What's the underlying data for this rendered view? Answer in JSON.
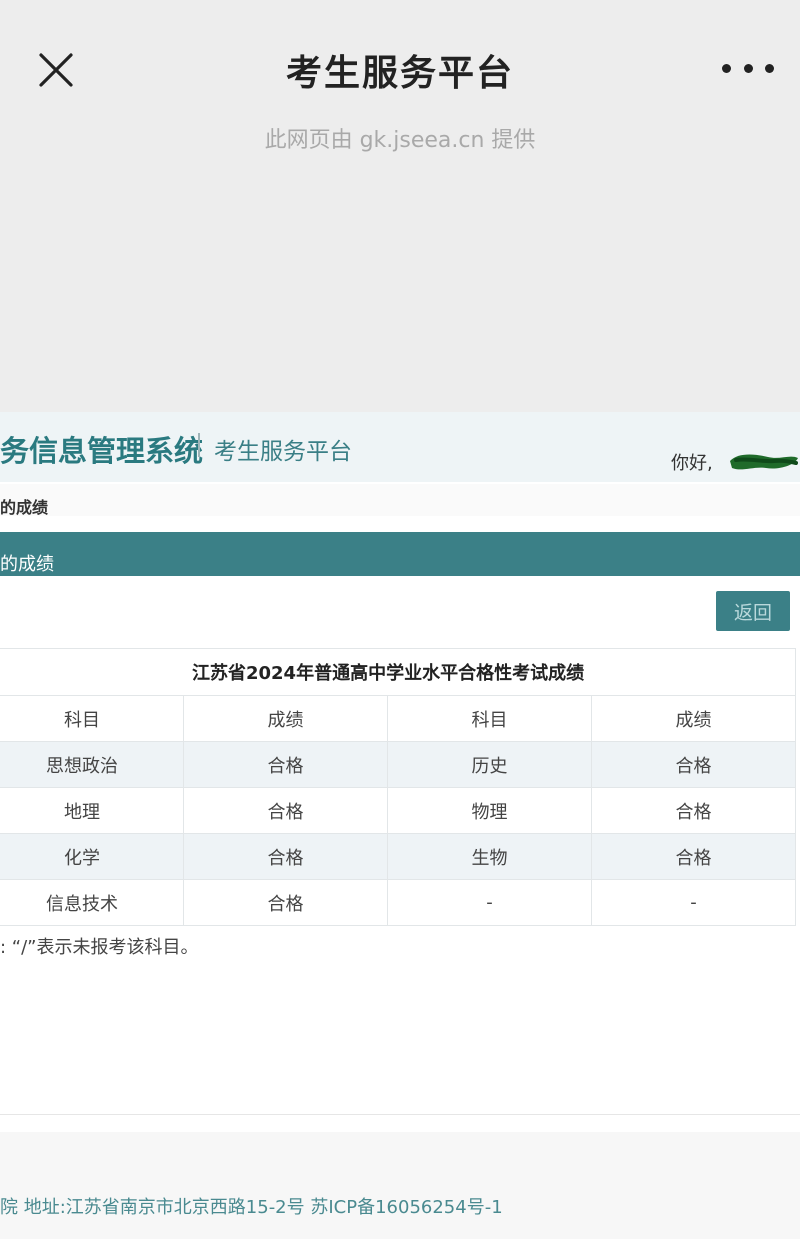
{
  "wechat": {
    "title": "考生服务平台",
    "source": "此网页由 gk.jseea.cn 提供"
  },
  "system": {
    "title": "务信息管理系统",
    "subtitle": "考生服务平台",
    "greeting": "你好,"
  },
  "breadcrumb": "的成绩",
  "section_bar": "的成绩",
  "back_button": "返回",
  "table": {
    "caption": "江苏省2024年普通高中学业水平合格性考试成绩",
    "headers": [
      "科目",
      "成绩",
      "科目",
      "成绩"
    ],
    "rows": [
      [
        "思想政治",
        "合格",
        "历史",
        "合格"
      ],
      [
        "地理",
        "合格",
        "物理",
        "合格"
      ],
      [
        "化学",
        "合格",
        "生物",
        "合格"
      ],
      [
        "信息技术",
        "合格",
        "-",
        "-"
      ]
    ]
  },
  "note": ": “/”表示未报考该科目。",
  "footer": "院 地址:江苏省南京市北京西路15-2号 苏ICP备16056254号-1",
  "colors": {
    "accent": "#3b8087",
    "title_text": "#2a7a80",
    "row_shade": "#eef3f6",
    "header_bg": "#ededed"
  }
}
